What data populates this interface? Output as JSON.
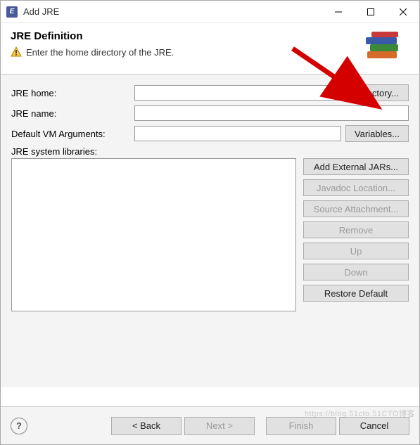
{
  "window": {
    "title": "Add JRE"
  },
  "banner": {
    "heading": "JRE Definition",
    "message": "Enter the home directory of the JRE."
  },
  "form": {
    "jre_home_label": "JRE home:",
    "jre_home_value": "",
    "jre_name_label": "JRE name:",
    "jre_name_value": "",
    "vm_args_label": "Default VM Arguments:",
    "vm_args_value": "",
    "directory_btn": "Directory...",
    "variables_btn": "Variables...",
    "libraries_label": "JRE system libraries:",
    "add_external": "Add External JARs...",
    "javadoc": "Javadoc Location...",
    "source": "Source Attachment...",
    "remove": "Remove",
    "up": "Up",
    "down": "Down",
    "restore": "Restore Default"
  },
  "footer": {
    "back": "< Back",
    "next": "Next >",
    "finish": "Finish",
    "cancel": "Cancel"
  },
  "watermark": "https://blog.51cto.51CTO博客"
}
